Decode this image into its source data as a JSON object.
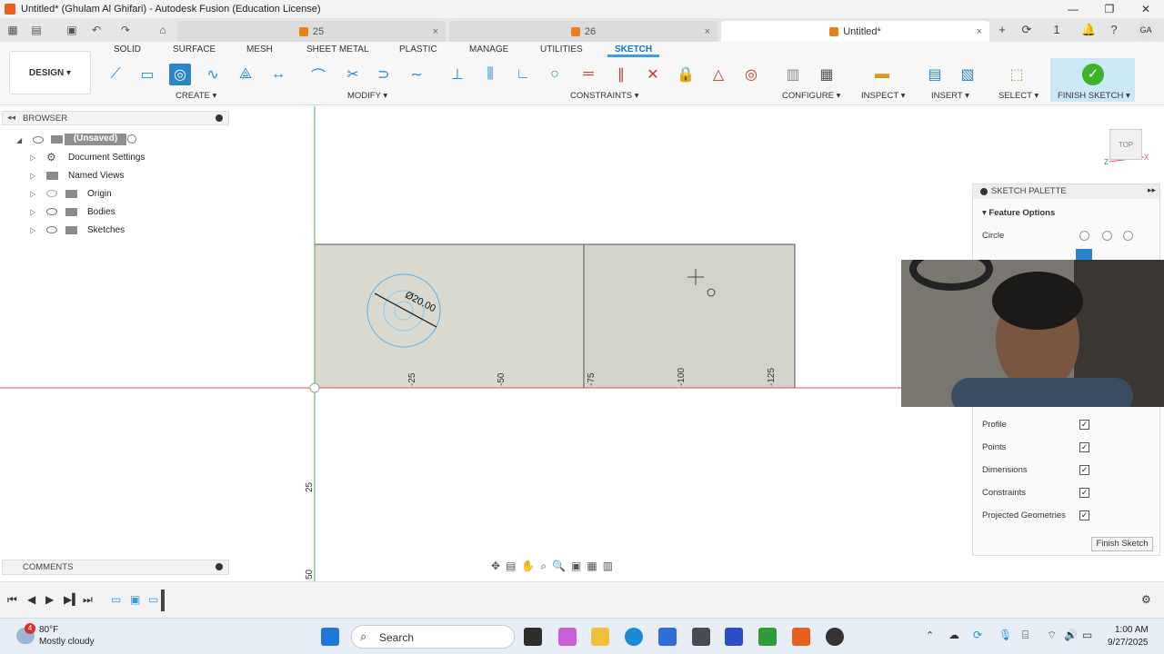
{
  "window": {
    "title": "Untitled* (Ghulam Al Ghifari) - Autodesk Fusion (Education License)",
    "minimize": "—",
    "maximize": "❐",
    "close": "✕"
  },
  "tabs": [
    {
      "label": "25"
    },
    {
      "label": "26"
    },
    {
      "label": "Untitled*"
    }
  ],
  "tab_close": "×",
  "user_initials": "GA",
  "notification_count": "1",
  "ribbon": {
    "tabs": [
      "SOLID",
      "SURFACE",
      "MESH",
      "SHEET METAL",
      "PLASTIC",
      "MANAGE",
      "UTILITIES",
      "SKETCH"
    ],
    "active_tab": "SKETCH",
    "workspace": "DESIGN ▾",
    "groups": [
      "CREATE ▾",
      "MODIFY ▾",
      "CONSTRAINTS ▾",
      "CONFIGURE ▾",
      "INSPECT ▾",
      "INSERT ▾",
      "SELECT ▾",
      "FINISH SKETCH ▾"
    ]
  },
  "browser": {
    "title": "BROWSER",
    "root": "(Unsaved)",
    "items": [
      "Document Settings",
      "Named Views",
      "Origin",
      "Bodies",
      "Sketches"
    ]
  },
  "comments": {
    "title": "COMMENTS"
  },
  "viewcube": {
    "face": "TOP"
  },
  "canvas": {
    "axis_labels_x": [
      "-25",
      "-50",
      "-75",
      "-100",
      "-125"
    ],
    "axis_labels_y": [
      "25",
      "50"
    ],
    "circle_dimension": "Ø20.00"
  },
  "sketch_palette": {
    "title": "SKETCH PALETTE",
    "section": "Feature Options",
    "circle_label": "Circle",
    "options": [
      {
        "label": "Profile",
        "checked": true
      },
      {
        "label": "Points",
        "checked": true
      },
      {
        "label": "Dimensions",
        "checked": true
      },
      {
        "label": "Constraints",
        "checked": true
      },
      {
        "label": "Projected Geometries",
        "checked": true
      }
    ],
    "finish_button": "Finish Sketch"
  },
  "taskbar": {
    "weather_temp": "80°F",
    "weather_desc": "Mostly cloudy",
    "weather_badge": "4",
    "search": "Search",
    "time": "1:00 AM",
    "date": "9/27/2025"
  },
  "colors": {
    "accent": "#0a7dc4",
    "sketch_fill": "#d9d9cf",
    "finish_green": "#3cb32a",
    "axis_red": "#e05050",
    "axis_green": "#4caf50"
  }
}
